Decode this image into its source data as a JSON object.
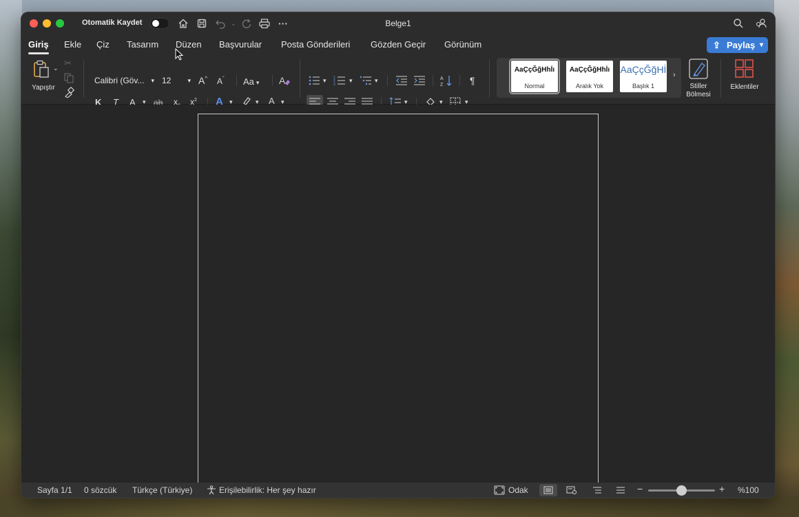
{
  "titlebar": {
    "autosave_label": "Otomatik Kaydet",
    "document_title": "Belge1"
  },
  "tabs": [
    {
      "label": "Giriş",
      "active": true
    },
    {
      "label": "Ekle"
    },
    {
      "label": "Çiz"
    },
    {
      "label": "Tasarım"
    },
    {
      "label": "Düzen"
    },
    {
      "label": "Başvurular"
    },
    {
      "label": "Posta Gönderileri"
    },
    {
      "label": "Gözden Geçir"
    },
    {
      "label": "Görünüm"
    }
  ],
  "share_button": {
    "label": "Paylaş"
  },
  "ribbon": {
    "paste_label": "Yapıştır",
    "font_name": "Calibri (Göv...",
    "font_size": "12",
    "change_case": "Aa",
    "bold": "K",
    "italic": "T",
    "underline": "A",
    "strikethrough": "ab",
    "subscript": "x",
    "superscript": "x",
    "font_color_letter": "A",
    "styles": [
      {
        "sample": "AaÇçĞğHhİı",
        "name": "Normal",
        "selected": true
      },
      {
        "sample": "AaÇçĞğHhİı",
        "name": "Aralık Yok"
      },
      {
        "sample": "AaÇçĞğHİ",
        "name": "Başlık 1"
      }
    ],
    "styles_pane_line1": "Stiller",
    "styles_pane_line2": "Bölmesi",
    "addins_label": "Eklentiler"
  },
  "statusbar": {
    "page": "Sayfa 1/1",
    "words": "0 sözcük",
    "language": "Türkçe (Türkiye)",
    "accessibility": "Erişilebilirlik: Her şey hazır",
    "focus": "Odak",
    "zoom": "%100"
  },
  "colors": {
    "accent": "#3a7bd5",
    "highlight_yellow": "#f5e03a",
    "font_red": "#e03030",
    "window_bg": "#262626"
  }
}
